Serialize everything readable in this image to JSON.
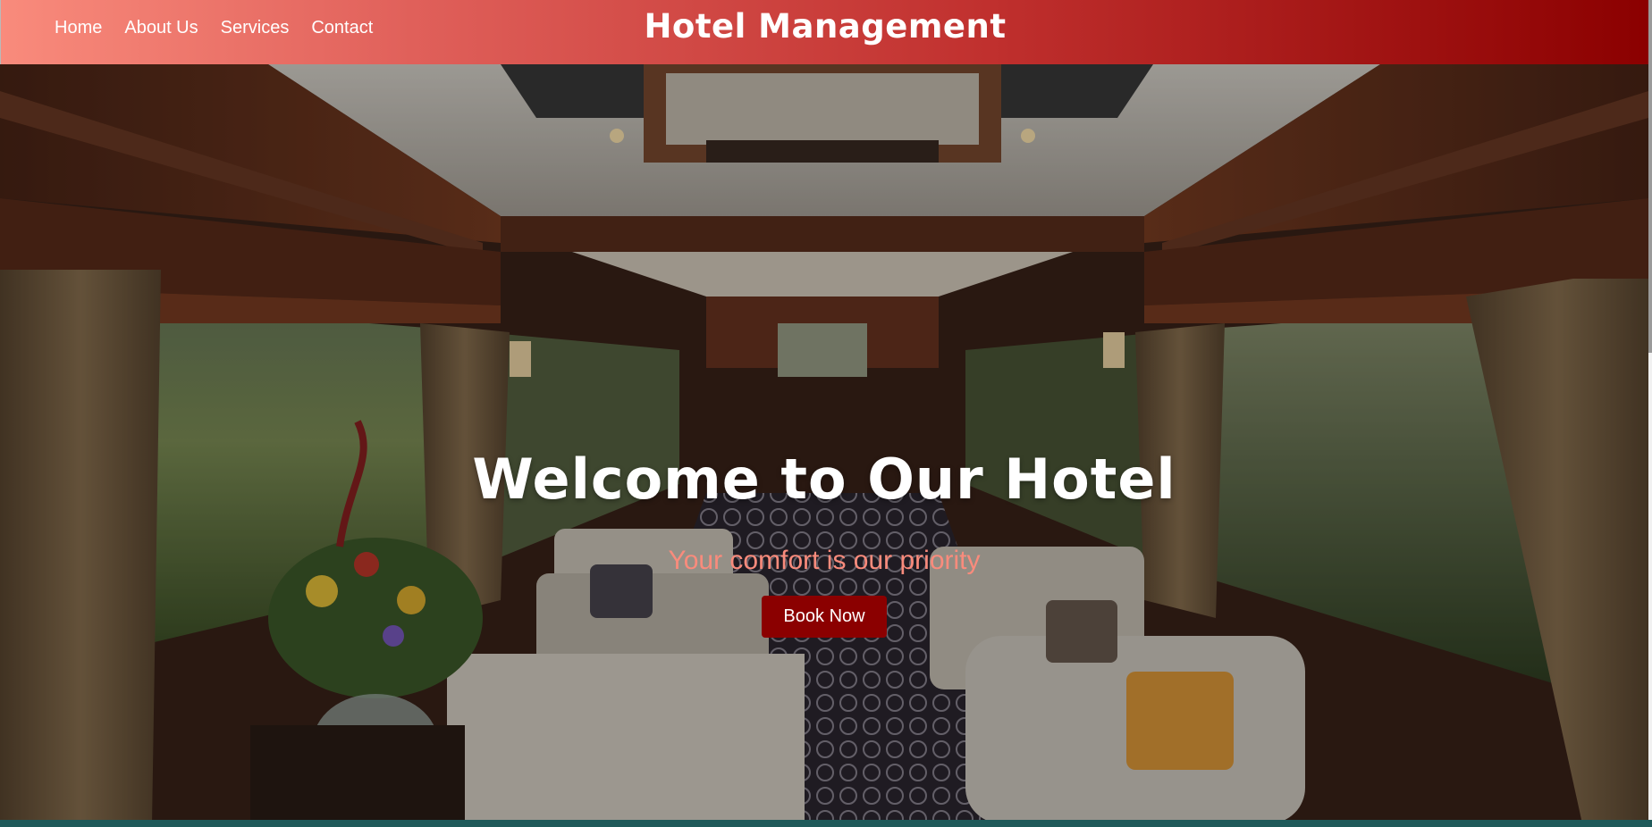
{
  "header": {
    "title": "Hotel Management",
    "nav": [
      {
        "label": "Home"
      },
      {
        "label": "About Us"
      },
      {
        "label": "Services"
      },
      {
        "label": "Contact"
      }
    ]
  },
  "hero": {
    "heading": "Welcome to Our Hotel",
    "tagline": "Your comfort is our priority",
    "cta_label": "Book Now",
    "background": "luxury-train-lounge-car-photo"
  },
  "colors": {
    "header_gradient_start": "#f98b7c",
    "header_gradient_end": "#8b0000",
    "tagline": "#f98b7c",
    "button": "#8b0000"
  }
}
